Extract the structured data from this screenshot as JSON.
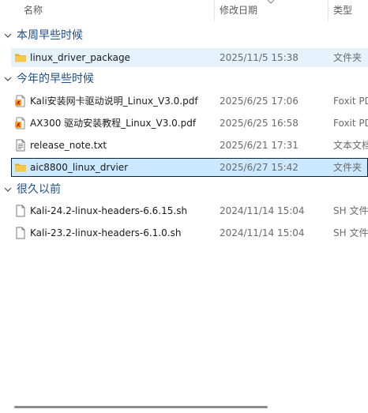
{
  "columns": {
    "name": "名称",
    "date": "修改日期",
    "type": "类型"
  },
  "groups": [
    {
      "label": "本周早些时候",
      "items": [
        {
          "name": "linux_driver_package",
          "date": "2025/11/5 15:38",
          "type": "文件夹",
          "icon": "folder-icon",
          "state": "selected"
        }
      ]
    },
    {
      "label": "今年的早些时候",
      "items": [
        {
          "name": "Kali安装网卡驱动说明_Linux_V3.0.pdf",
          "date": "2025/6/25 17:06",
          "type": "Foxit PDF",
          "icon": "pdf-icon",
          "state": ""
        },
        {
          "name": "AX300 驱动安装教程_Linux_V3.0.pdf",
          "date": "2025/6/25 16:58",
          "type": "Foxit PDF",
          "icon": "pdf-icon",
          "state": ""
        },
        {
          "name": "release_note.txt",
          "date": "2025/6/21 17:31",
          "type": "文本文档",
          "icon": "text-file-icon",
          "state": ""
        },
        {
          "name": "aic8800_linux_drvier",
          "date": "2025/6/27 15:42",
          "type": "文件夹",
          "icon": "folder-icon",
          "state": "focused"
        }
      ]
    },
    {
      "label": "很久以前",
      "items": [
        {
          "name": "Kali-24.2-linux-headers-6.6.15.sh",
          "date": "2024/11/14 15:04",
          "type": "SH 文件",
          "icon": "file-icon",
          "state": ""
        },
        {
          "name": "Kali-23.2-linux-headers-6.1.0.sh",
          "date": "2024/11/14 15:04",
          "type": "SH 文件",
          "icon": "file-icon",
          "state": ""
        }
      ]
    }
  ],
  "colors": {
    "group_label": "#1f4e8c",
    "selected_bg": "#e5f1fb",
    "focused_bg": "#cce8ff",
    "folder": "#f5c84c",
    "pdf_accent": "#c8102e"
  }
}
